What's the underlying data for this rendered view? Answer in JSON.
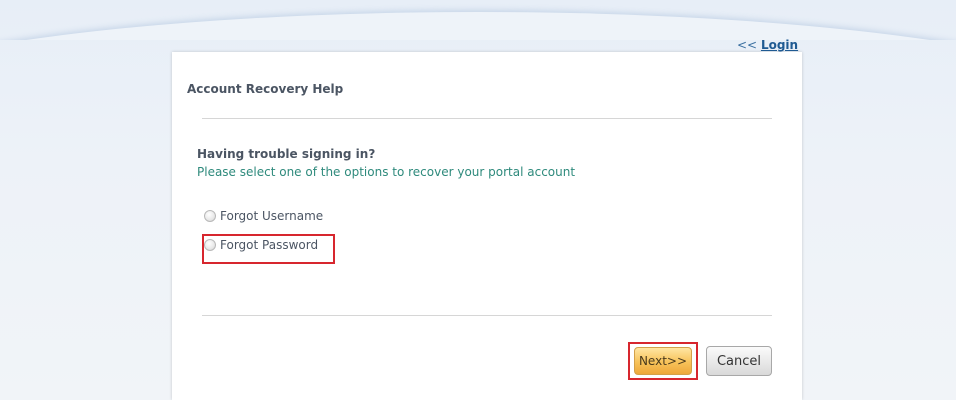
{
  "nav": {
    "back_arrows": "<<",
    "login_label": "Login"
  },
  "panel": {
    "title": "Account Recovery Help"
  },
  "content": {
    "heading": "Having trouble signing in?",
    "subtext": "Please select one of the options to recover your portal account"
  },
  "options": [
    {
      "label": "Forgot Username",
      "selected": false
    },
    {
      "label": "Forgot Password",
      "selected": false
    }
  ],
  "buttons": {
    "next_label": "Next>>",
    "cancel_label": "Cancel"
  },
  "colors": {
    "highlight": "#d7262e",
    "subtext": "#2e8a7c",
    "link": "#1f5a92"
  }
}
